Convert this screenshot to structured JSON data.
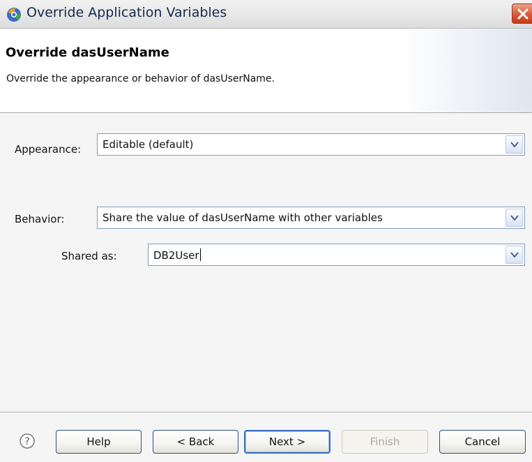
{
  "window": {
    "title": "Override Application Variables",
    "icons": {
      "app": "eclipse-app-icon",
      "close": "close-x-icon"
    }
  },
  "banner": {
    "title": "Override dasUserName",
    "description": "Override the appearance or behavior of dasUserName."
  },
  "form": {
    "appearance": {
      "label": "Appearance:",
      "value": "Editable (default)"
    },
    "behavior": {
      "label": "Behavior:",
      "value": "Share the value of dasUserName with other variables"
    },
    "shared_as": {
      "label": "Shared as:",
      "value": "DB2User"
    }
  },
  "footer": {
    "help_icon": "question-mark-icon",
    "buttons": {
      "help": "Help",
      "back": "< Back",
      "next": "Next >",
      "finish": "Finish",
      "cancel": "Cancel"
    }
  },
  "colors": {
    "title_text": "#12294f",
    "close_button": "#d9593a",
    "combo_border": "#7f9db9",
    "default_button_border": "#3b6fc4"
  }
}
